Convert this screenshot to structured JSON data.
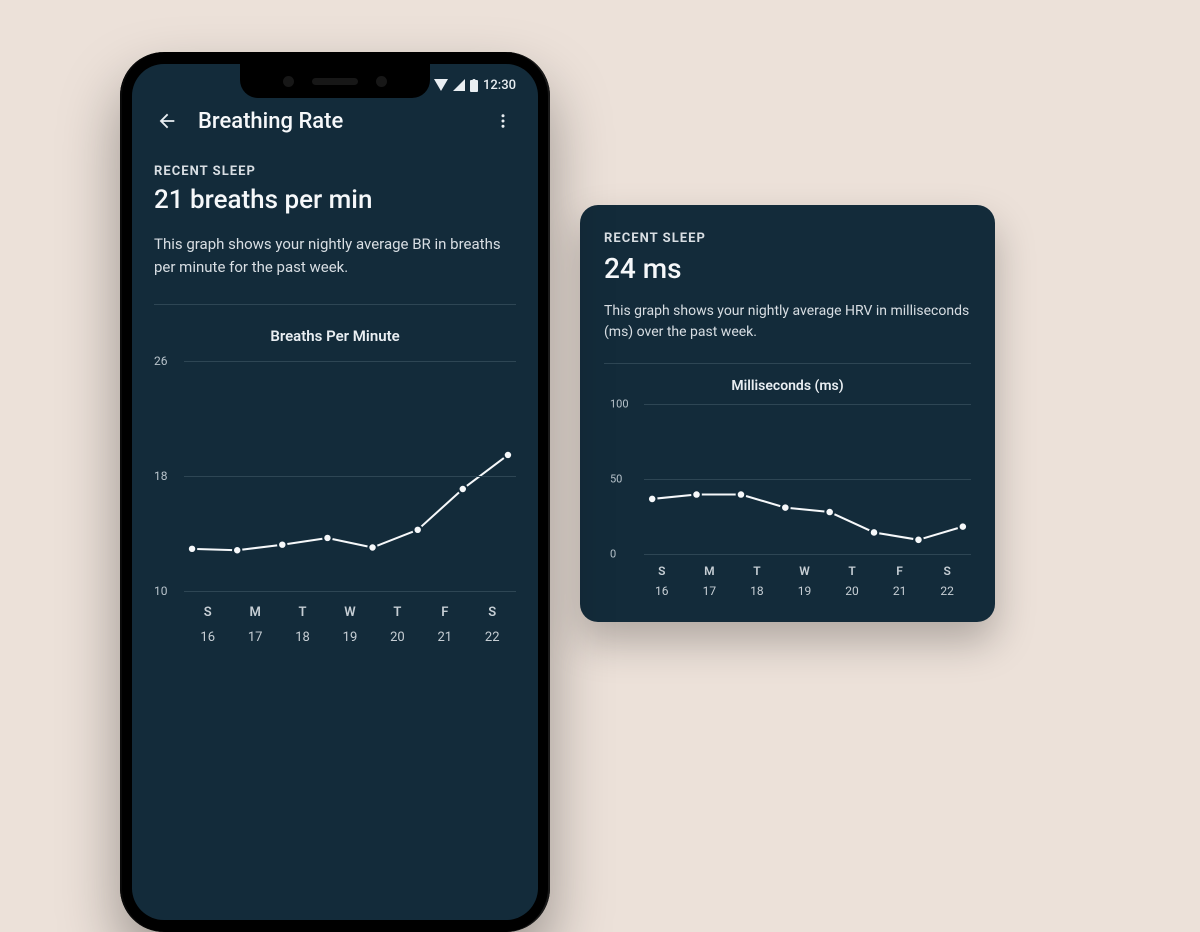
{
  "statusbar": {
    "time": "12:30"
  },
  "header": {
    "title": "Breathing Rate"
  },
  "phoneScreen": {
    "label": "RECENT SLEEP",
    "value": "21 breaths per min",
    "desc": "This graph shows your nightly average BR in breaths per minute for the past week."
  },
  "card": {
    "label": "RECENT SLEEP",
    "value": "24 ms",
    "desc": "This graph shows your nightly average HRV in milliseconds (ms) over the past week."
  },
  "chart_data": [
    {
      "id": "breathing",
      "type": "line",
      "title": "Breaths Per Minute",
      "xlabel": "",
      "ylabel": "",
      "categories_dow": [
        "S",
        "M",
        "T",
        "W",
        "T",
        "F",
        "S"
      ],
      "categories_num": [
        "16",
        "17",
        "18",
        "19",
        "20",
        "21",
        "22"
      ],
      "y_ticks": [
        26,
        18,
        10
      ],
      "ylim": [
        10,
        27
      ],
      "values": [
        13.2,
        13.1,
        13.5,
        14.0,
        13.3,
        14.6,
        17.6,
        20.1
      ]
    },
    {
      "id": "hrv",
      "type": "line",
      "title": "Milliseconds (ms)",
      "xlabel": "",
      "ylabel": "",
      "categories_dow": [
        "S",
        "M",
        "T",
        "W",
        "T",
        "F",
        "S"
      ],
      "categories_num": [
        "16",
        "17",
        "18",
        "19",
        "20",
        "21",
        "22"
      ],
      "y_ticks": [
        100,
        50,
        0
      ],
      "ylim": [
        0,
        105
      ],
      "values": [
        40,
        43,
        43,
        34,
        31,
        17,
        12,
        21
      ]
    }
  ]
}
